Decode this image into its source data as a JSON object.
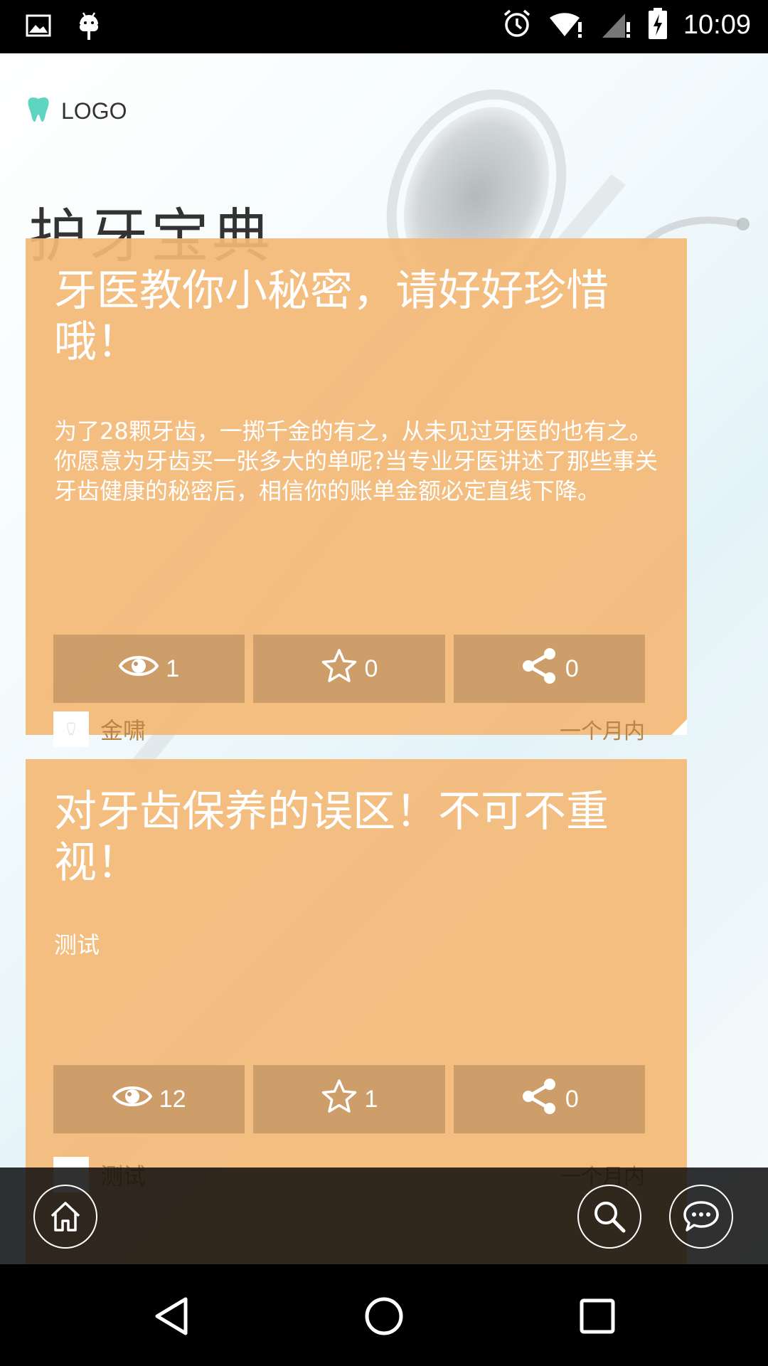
{
  "status_bar": {
    "time": "10:09"
  },
  "header": {
    "logo_text": "LOGO",
    "page_title": "护牙宝典"
  },
  "articles": [
    {
      "title": "牙医教你小秘密，请好好珍惜哦！",
      "description": "为了28颗牙齿，一掷千金的有之，从未见过牙医的也有之。你愿意为牙齿买一张多大的单呢?当专业牙医讲述了那些事关牙齿健康的秘密后，相信你的账单金额必定直线下降。",
      "views": "1",
      "stars": "0",
      "shares": "0",
      "author": "金啸",
      "time": "一个月内"
    },
    {
      "title": "对牙齿保养的误区！不可不重视！",
      "description": "测试",
      "views": "12",
      "stars": "1",
      "shares": "0",
      "author": "测试",
      "time": "一个月内"
    }
  ],
  "colors": {
    "card": "#f4b976",
    "stat_button": "#c29565",
    "meta_text": "#b98447",
    "title_text": "#333333"
  },
  "icons": {
    "views": "eye-icon",
    "stars": "star-icon",
    "shares": "share-icon",
    "bottom_left": "home-icon",
    "bottom_middle": "search-icon",
    "bottom_right": "chat-icon"
  }
}
